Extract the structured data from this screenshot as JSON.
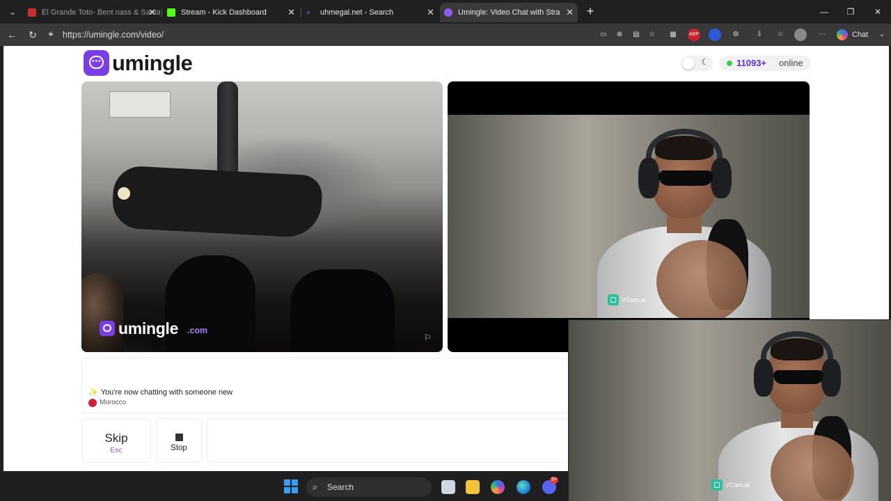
{
  "browser": {
    "tabs": [
      {
        "title": "El Grande Toto- Bent nass & Santa",
        "icon": "youtube-icon",
        "color": "#c4302b"
      },
      {
        "title": "Stream - Kick Dashboard",
        "icon": "kick-icon",
        "color": "#53fc18"
      },
      {
        "title": "uhmegal.net - Search",
        "icon": "search-icon",
        "color": "#4aa3ff"
      },
      {
        "title": "Umingle: Video Chat with Stra",
        "icon": "umingle-icon",
        "color": "#8e5cf0"
      }
    ],
    "address": "https://umingle.com/video/",
    "chat_label": "Chat"
  },
  "page": {
    "logo": "umingle",
    "online_count": "11093+",
    "online_label": "online",
    "watermark_name": "umingle",
    "watermark_tld": ".com",
    "vcam_label": "VCam.ai",
    "chat": {
      "message": "You're now chatting with someone new",
      "sparkle": "✨",
      "country": "Morocco"
    },
    "buttons": {
      "skip_label": "Skip",
      "skip_hint": "Esc",
      "stop_label": "Stop"
    }
  },
  "taskbar": {
    "search_label": "Search",
    "discord_badge": "9+"
  },
  "colors": {
    "accent": "#7a3fe4",
    "online_count": "#5a2fd3",
    "online_dot": "#3dcc54"
  }
}
